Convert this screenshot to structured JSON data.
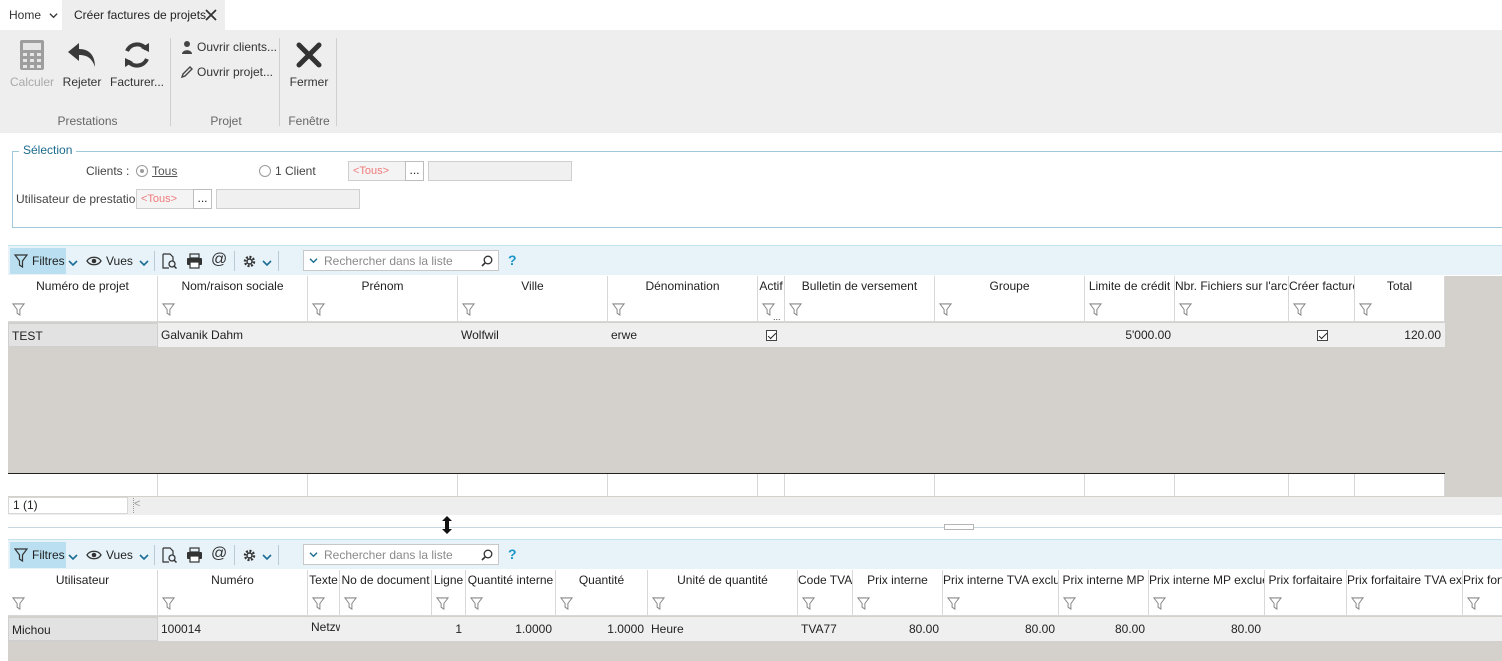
{
  "tabs": {
    "home": "Home",
    "active": "Créer factures de projets"
  },
  "ribbon": {
    "groups": {
      "prestations": "Prestations",
      "projet": "Projet",
      "fenetre": "Fenêtre"
    },
    "calculer": "Calculer",
    "rejeter": "Rejeter",
    "facturer": "Facturer...",
    "ouvrir_clients": "Ouvrir clients...",
    "ouvrir_projet": "Ouvrir projet...",
    "fermer": "Fermer"
  },
  "selection": {
    "legend": "Sélection",
    "clients_label": "Clients :",
    "tous": "Tous",
    "un_client": "1 Client",
    "client_lookup": "<Tous>",
    "dots": "...",
    "user_label": "Utilisateur de prestation :",
    "user_lookup": "<Tous>"
  },
  "toolbar": {
    "filtres": "Filtres",
    "vues": "Vues",
    "search_placeholder": "Rechercher dans la liste",
    "help": "?"
  },
  "grid1": {
    "columns": [
      "Numéro de projet",
      "Nom/raison sociale",
      "Prénom",
      "Ville",
      "Dénomination",
      "Actif",
      "Bulletin de versement",
      "Groupe",
      "Limite de crédit",
      "Nbr. Fichiers sur l'arch.",
      "Créer facture",
      "Total"
    ],
    "rows": [
      {
        "numero": "TEST",
        "nom": "Galvanik Dahm",
        "prenom": "",
        "ville": "Wolfwil",
        "denomination": "erwe",
        "actif": true,
        "bulletin": "",
        "groupe": "",
        "limite": "5'000.00",
        "fichiers": "",
        "creer_facture": true,
        "total": "120.00"
      }
    ],
    "status_count": "1 (1)",
    "filter_overflow": "..."
  },
  "grid2": {
    "columns": [
      "Utilisateur",
      "Numéro",
      "Texte",
      "No de document",
      "Ligne",
      "Quantité interne",
      "Quantité",
      "Unité de quantité",
      "Code TVA",
      "Prix interne",
      "Prix interne TVA exclue",
      "Prix interne MP",
      "Prix interne MP exclue",
      "Prix forfaitaire",
      "Prix forfaitaire TVA excl",
      "Prix forf"
    ],
    "rows": [
      {
        "utilisateur": "Michou",
        "numero": "100014",
        "texte": "Netzw",
        "no_document": "",
        "ligne": "1",
        "quantite_interne": "1.0000",
        "quantite": "1.0000",
        "unite": "Heure",
        "code_tva": "TVA77",
        "prix_interne": "80.00",
        "prix_interne_tva": "80.00",
        "prix_interne_mp": "80.00",
        "prix_interne_mp_exclue": "80.00",
        "prix_forfaitaire": "",
        "prix_forfaitaire_tva": "",
        "prix_forf": ""
      }
    ]
  },
  "colors": {
    "ribbon_bg": "#eeeeee",
    "toolbar_bg": "#e7f3f9",
    "filter_active": "#b9dff0",
    "grid_empty": "#d4d0cb",
    "accent": "#1b95c9"
  }
}
